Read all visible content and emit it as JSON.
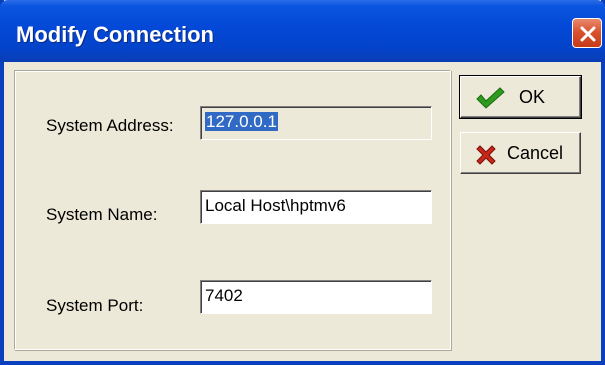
{
  "window": {
    "title": "Modify Connection"
  },
  "form": {
    "address_label": "System Address:",
    "address_value": "127.0.0.1",
    "name_label": "System Name:",
    "name_value": "Local Host\\hptmv6",
    "port_label": "System Port:",
    "port_value": "7402"
  },
  "buttons": {
    "ok_label": "OK",
    "cancel_label": "Cancel"
  },
  "colors": {
    "titlebar": "#0348D6",
    "dialog_background": "#ECE9D8",
    "selection": "#316AC5",
    "ok_checkmark": "#2E9B1F",
    "cancel_cross": "#C8281C",
    "close_button": "#D9532F"
  },
  "icons": {
    "close": "close-icon",
    "ok": "checkmark-icon",
    "cancel": "red-x-icon"
  }
}
